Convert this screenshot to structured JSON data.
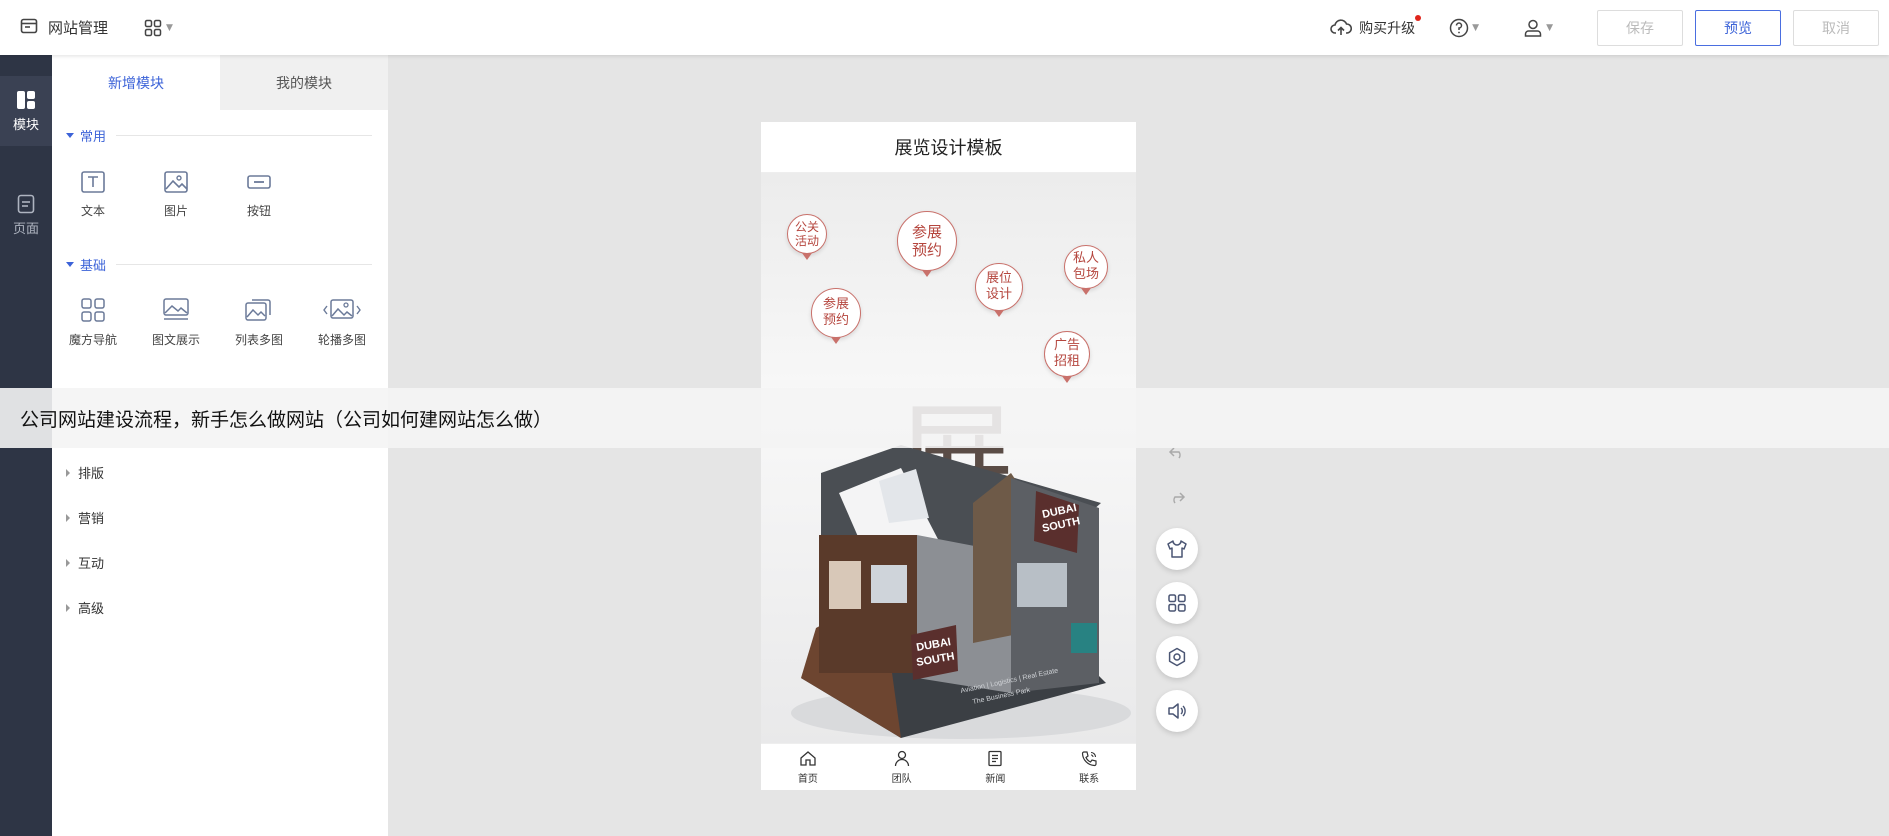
{
  "topbar": {
    "title": "网站管理",
    "upgrade": "购买升级",
    "save": "保存",
    "preview": "预览",
    "cancel": "取消"
  },
  "leftnav": {
    "items": [
      {
        "label": "模块",
        "active": true
      },
      {
        "label": "页面",
        "active": false
      }
    ]
  },
  "panel": {
    "tabs": [
      "新增模块",
      "我的模块"
    ],
    "sections": {
      "common": "常用",
      "basic": "基础"
    },
    "common_modules": [
      "文本",
      "图片",
      "按钮"
    ],
    "basic_modules": [
      "魔方导航",
      "图文展示",
      "列表多图",
      "轮播多图"
    ],
    "collapsed": [
      "排版",
      "营销",
      "互动",
      "高级"
    ]
  },
  "phone": {
    "title": "展览设计模板",
    "bubbles": [
      "公关活动",
      "参展预约",
      "展位设计",
      "私人包场",
      "参展预约",
      "广告招租"
    ],
    "big_char": "展",
    "booth_text": [
      "DUBAI",
      "SOUTH",
      "Aviation | Logistics | Real Estate",
      "The Business Park"
    ],
    "nav": [
      "首页",
      "团队",
      "新闻",
      "联系"
    ]
  },
  "overlay": {
    "text": "公司网站建设流程，新手怎么做网站（公司如何建网站怎么做）"
  },
  "colors": {
    "accent": "#3c63d8",
    "sidebar": "#2e3545",
    "bubble": "#b5463e"
  }
}
